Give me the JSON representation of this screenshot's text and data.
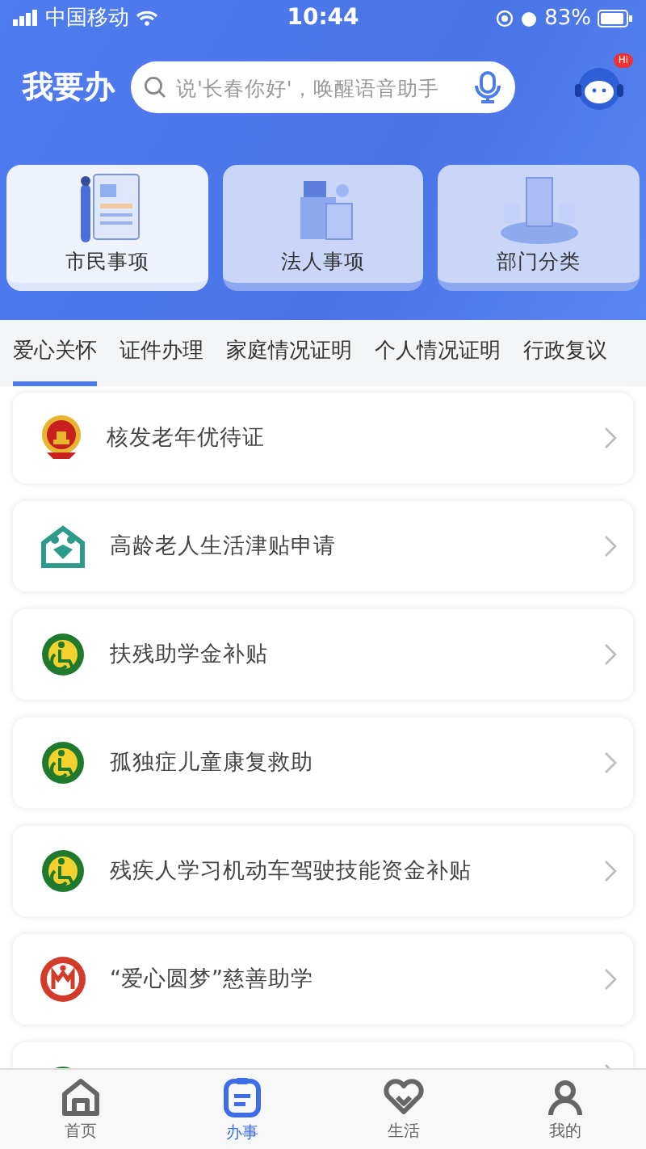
{
  "status_bar": {
    "carrier": "中国移动",
    "time": "10:44",
    "battery": "83%"
  },
  "header": {
    "title": "我要办",
    "search": {
      "placeholder": "说'长春你好'，唤醒语音助手"
    },
    "badge": "Hi"
  },
  "categories": [
    {
      "label": "市民事项",
      "kind": "citizen",
      "selected": true
    },
    {
      "label": "法人事项",
      "kind": "corporate",
      "selected": false
    },
    {
      "label": "部门分类",
      "kind": "department",
      "selected": false
    }
  ],
  "tabs": [
    {
      "label": "爱心关怀",
      "selected": true
    },
    {
      "label": "证件办理",
      "selected": false
    },
    {
      "label": "家庭情况证明",
      "selected": false
    },
    {
      "label": "个人情况证明",
      "selected": false
    },
    {
      "label": "行政复议",
      "selected": false
    }
  ],
  "items": [
    {
      "title": "核发老年优待证",
      "kind": "emblem"
    },
    {
      "title": "高龄老人生活津贴申请",
      "kind": "elderly"
    },
    {
      "title": "扶残助学金补贴",
      "kind": "disabled"
    },
    {
      "title": "孤独症儿童康复救助",
      "kind": "disabled"
    },
    {
      "title": "残疾人学习机动车驾驶技能资金补贴",
      "kind": "disabled"
    },
    {
      "title": "“爱心圆梦”慈善助学",
      "kind": "charity"
    },
    {
      "kind": "disabled"
    }
  ],
  "bottom_nav": [
    {
      "label": "首页",
      "kind": "home",
      "selected": false
    },
    {
      "label": "办事",
      "kind": "tasks",
      "selected": true
    },
    {
      "label": "生活",
      "kind": "life",
      "selected": false
    },
    {
      "label": "我的",
      "kind": "me",
      "selected": false
    }
  ]
}
